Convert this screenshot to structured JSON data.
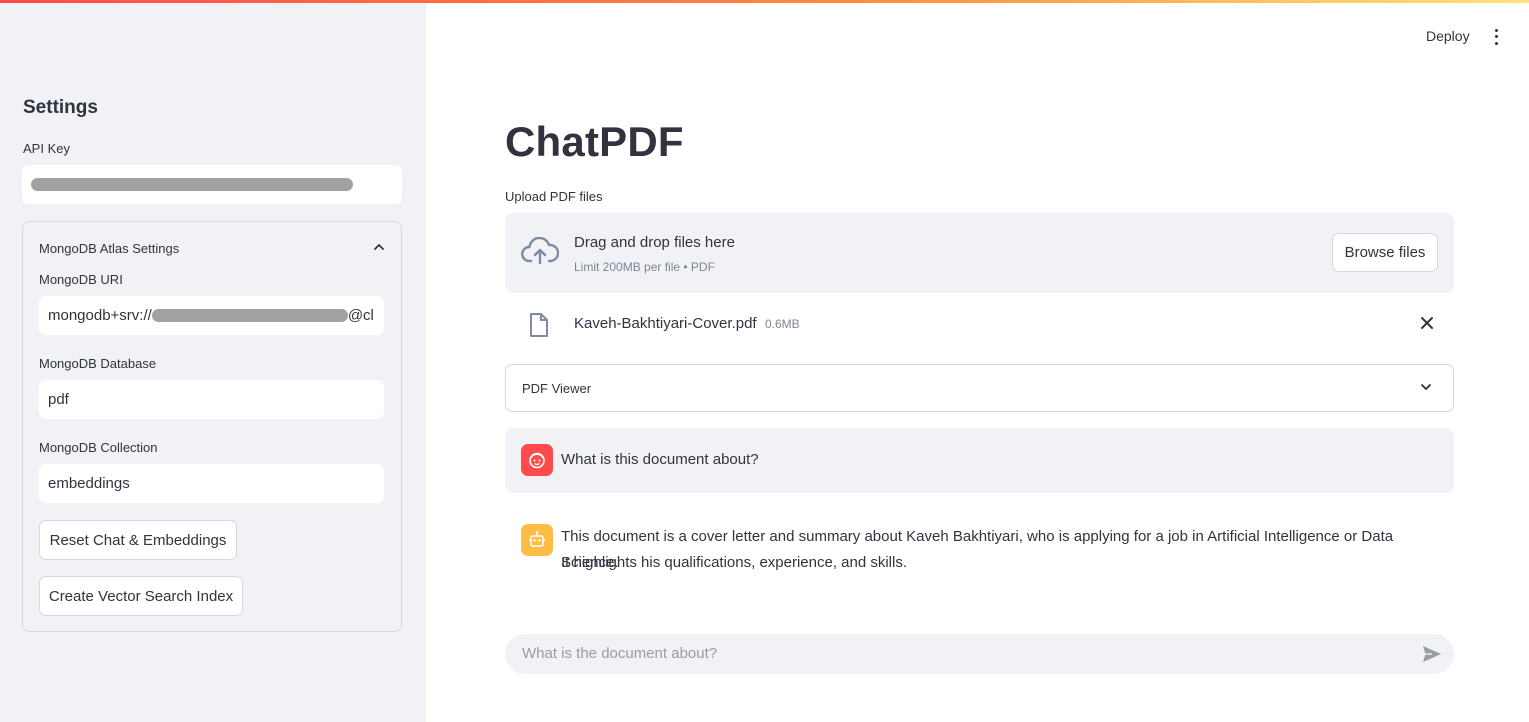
{
  "header": {
    "deploy_label": "Deploy"
  },
  "sidebar": {
    "title": "Settings",
    "api_key": {
      "label": "API Key",
      "value": ""
    },
    "mongodb_expander": {
      "label": "MongoDB Atlas Settings",
      "uri": {
        "label": "MongoDB URI",
        "value_prefix": "mongodb+srv://",
        "value_suffix": "@cl"
      },
      "database": {
        "label": "MongoDB Database",
        "value": "pdf"
      },
      "collection": {
        "label": "MongoDB Collection",
        "value": "embeddings"
      },
      "reset_button": "Reset Chat & Embeddings",
      "create_index_button": "Create Vector Search Index"
    }
  },
  "main": {
    "title": "ChatPDF",
    "uploader": {
      "label": "Upload PDF files",
      "drop_text": "Drag and drop files here",
      "limit_text": "Limit 200MB per file • PDF",
      "browse_label": "Browse files"
    },
    "uploaded_file": {
      "name": "Kaveh-Bakhtiyari-Cover.pdf",
      "size": "0.6MB"
    },
    "pdf_viewer_label": "PDF Viewer",
    "messages": [
      {
        "role": "user",
        "text": "What is this document about?"
      },
      {
        "role": "assistant",
        "lines": [
          "This document is a cover letter and summary about Kaveh Bakhtiyari, who is applying for a job in Artificial Intelligence or Data Science.",
          "It highlights his qualifications, experience, and skills."
        ]
      }
    ],
    "chat_input": {
      "placeholder": "What is the document about?"
    }
  },
  "colors": {
    "accent_red": "#ff4b4b",
    "assistant_avatar": "#ffbd45",
    "sidebar_bg": "#f0f2f6",
    "text": "#31333f"
  }
}
